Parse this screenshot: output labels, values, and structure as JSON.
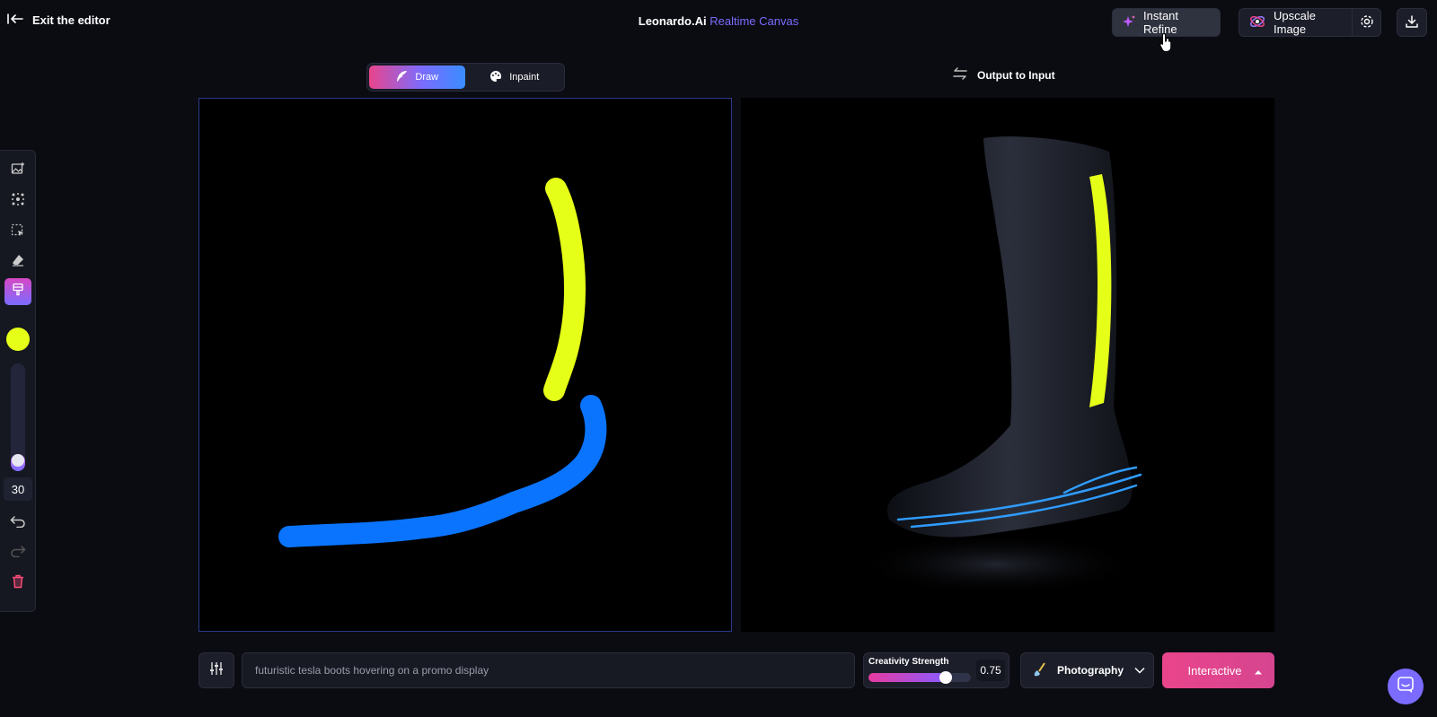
{
  "header": {
    "exit_label": "Exit the editor",
    "brand": "Leonardo.Ai",
    "brand_suffix": "Realtime Canvas",
    "instant_refine_label": "Instant Refine",
    "upscale_label": "Upscale Image"
  },
  "modes": {
    "draw_label": "Draw",
    "inpaint_label": "Inpaint",
    "active": "draw"
  },
  "output_to_input_label": "Output to Input",
  "toolbar": {
    "tools": [
      "add-image",
      "object-detect",
      "select",
      "eraser",
      "brush"
    ],
    "active_tool": "brush",
    "brush_color": "#e6ff18",
    "brush_size": "30",
    "brush_size_fraction": 0.16
  },
  "strokes": [
    {
      "color": "#e6ff18"
    },
    {
      "color": "#0a74ff"
    }
  ],
  "prompt": {
    "value": "futuristic tesla boots hovering on a promo display"
  },
  "creativity": {
    "label": "Creativity Strength",
    "value": "0.75",
    "fraction": 0.75
  },
  "style": {
    "label": "Photography"
  },
  "generate": {
    "label": "Interactive"
  },
  "colors": {
    "accent": "#7b6cff",
    "pink": "#e9458b",
    "background": "#0b0c12"
  }
}
